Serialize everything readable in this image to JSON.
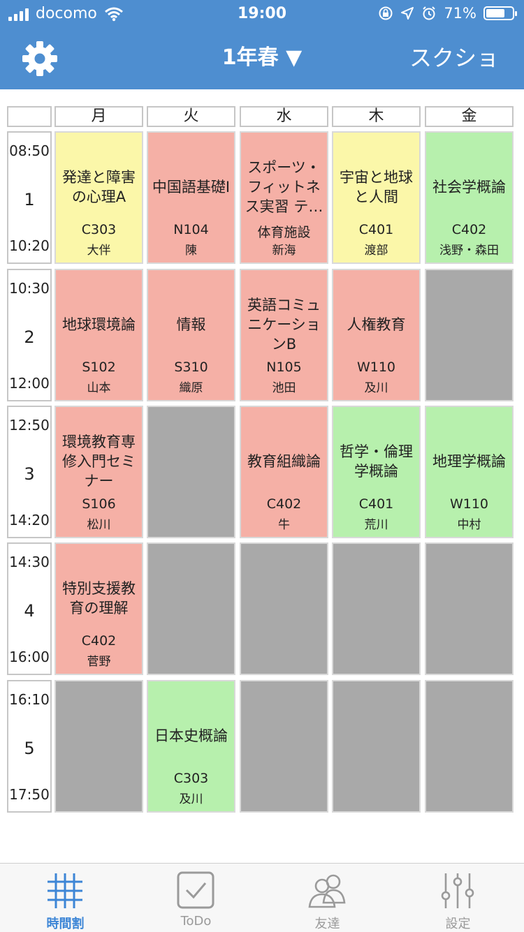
{
  "status_bar": {
    "carrier": "docomo",
    "time": "19:00",
    "battery_percent": "71%"
  },
  "nav": {
    "title": "1年春 ▼",
    "right_button": "スクショ",
    "left_icon": "gear-icon"
  },
  "days": [
    "月",
    "火",
    "水",
    "木",
    "金"
  ],
  "periods": [
    {
      "number": "1",
      "start": "08:50",
      "end": "10:20"
    },
    {
      "number": "2",
      "start": "10:30",
      "end": "12:00"
    },
    {
      "number": "3",
      "start": "12:50",
      "end": "14:20"
    },
    {
      "number": "4",
      "start": "14:30",
      "end": "16:00"
    },
    {
      "number": "5",
      "start": "16:10",
      "end": "17:50"
    }
  ],
  "colors": {
    "header_blue": "#4e8ed0",
    "red": "#f5b0a6",
    "yellow": "#fbf7a9",
    "green": "#b7f0ad",
    "empty": "#a9a9a9",
    "tab_active": "#3d86d6"
  },
  "timetable": [
    [
      {
        "name": "発達と障害の心理A",
        "room": "C303",
        "teacher": "大伴",
        "color": "yellow"
      },
      {
        "name": "中国語基礎I",
        "room": "N104",
        "teacher": "陳",
        "color": "red"
      },
      {
        "name": "スポーツ・フィットネス実習 テ…",
        "room": "体育施設",
        "teacher": "新海",
        "color": "red"
      },
      {
        "name": "宇宙と地球と人間",
        "room": "C401",
        "teacher": "渡部",
        "color": "yellow"
      },
      {
        "name": "社会学概論",
        "room": "C402",
        "teacher": "浅野・森田",
        "color": "green"
      }
    ],
    [
      {
        "name": "地球環境論",
        "room": "S102",
        "teacher": "山本",
        "color": "red"
      },
      {
        "name": "情報",
        "room": "S310",
        "teacher": "織原",
        "color": "red"
      },
      {
        "name": "英語コミュニケーションB",
        "room": "N105",
        "teacher": "池田",
        "color": "red"
      },
      {
        "name": "人権教育",
        "room": "W110",
        "teacher": "及川",
        "color": "red"
      },
      null
    ],
    [
      {
        "name": "環境教育専修入門セミナー",
        "room": "S106",
        "teacher": "松川",
        "color": "red"
      },
      null,
      {
        "name": "教育組織論",
        "room": "C402",
        "teacher": "牛",
        "color": "red"
      },
      {
        "name": "哲学・倫理学概論",
        "room": "C401",
        "teacher": "荒川",
        "color": "green"
      },
      {
        "name": "地理学概論",
        "room": "W110",
        "teacher": "中村",
        "color": "green"
      }
    ],
    [
      {
        "name": "特別支援教育の理解",
        "room": "C402",
        "teacher": "菅野",
        "color": "red"
      },
      null,
      null,
      null,
      null
    ],
    [
      null,
      {
        "name": "日本史概論",
        "room": "C303",
        "teacher": "及川",
        "color": "green"
      },
      null,
      null,
      null
    ]
  ],
  "tabs": [
    {
      "label": "時間割",
      "icon": "grid-icon",
      "active": true
    },
    {
      "label": "ToDo",
      "icon": "checkbox-icon",
      "active": false
    },
    {
      "label": "友達",
      "icon": "friends-icon",
      "active": false
    },
    {
      "label": "設定",
      "icon": "sliders-icon",
      "active": false
    }
  ]
}
